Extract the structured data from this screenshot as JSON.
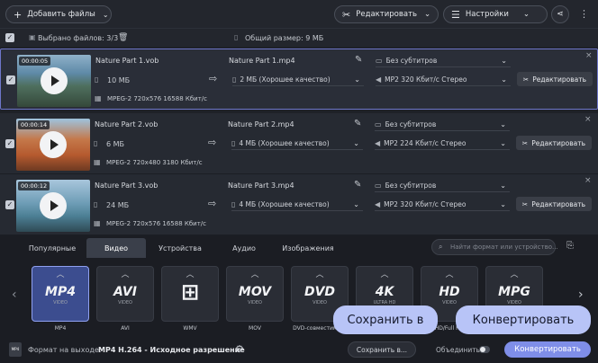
{
  "toolbar": {
    "add_files": "Добавить файлы",
    "edit": "Редактировать",
    "settings": "Настройки"
  },
  "subbar": {
    "selected": "Выбрано файлов: 3/3",
    "total_size": "Общий размер: 9 МБ"
  },
  "files": [
    {
      "duration": "00:00:05",
      "name": "Nature Part 1.vob",
      "size": "10 МБ",
      "meta": "MPEG-2 720x576 16588 Кбит/с",
      "out_name": "Nature Part 1.mp4",
      "out_size": "2 МБ (Хорошее качество)",
      "subs": "Без субтитров",
      "audio": "MP2 320 Кбит/с Стерео",
      "edit": "Редактировать"
    },
    {
      "duration": "00:00:14",
      "name": "Nature Part 2.vob",
      "size": "6 МБ",
      "meta": "MPEG-2 720x480 3180 Кбит/с",
      "out_name": "Nature Part 2.mp4",
      "out_size": "4 МБ (Хорошее качество)",
      "subs": "Без субтитров",
      "audio": "MP2 224 Кбит/с Стерео",
      "edit": "Редактировать"
    },
    {
      "duration": "00:00:12",
      "name": "Nature Part 3.vob",
      "size": "24 МБ",
      "meta": "MPEG-2 720x576 16588 Кбит/с",
      "out_name": "Nature Part 3.mp4",
      "out_size": "4 МБ (Хорошее качество)",
      "subs": "Без субтитров",
      "audio": "MP2 320 Кбит/с Стерео",
      "edit": "Редактировать"
    }
  ],
  "tabs": [
    "Популярные",
    "Видео",
    "Устройства",
    "Аудио",
    "Изображения"
  ],
  "search_placeholder": "Найти формат или устройство...",
  "formats": [
    {
      "logo": "MP4",
      "cap": "VIDEO",
      "label": "MP4"
    },
    {
      "logo": "AVI",
      "cap": "VIDEO",
      "label": "AVI"
    },
    {
      "logo": "⊞",
      "cap": "",
      "label": "WMV"
    },
    {
      "logo": "MOV",
      "cap": "VIDEO",
      "label": "MOV"
    },
    {
      "logo": "DVD",
      "cap": "VIDEO",
      "label": "DVD-совместимы..."
    },
    {
      "logo": "4K",
      "cap": "ULTRA HD",
      "label": "4K Ultra HD"
    },
    {
      "logo": "HD",
      "cap": "VIDEO",
      "label": "HD/Full HD"
    },
    {
      "logo": "MPG",
      "cap": "VIDEO",
      "label": "MPG"
    }
  ],
  "footer": {
    "format_label": "Формат на выходе:",
    "format_value": "MP4 H.264 - Исходное разрешение",
    "save_to": "Сохранить в...",
    "merge": "Объединить:",
    "convert": "Конвертировать"
  },
  "callouts": {
    "save": "Сохранить в",
    "convert": "Конвертировать"
  }
}
